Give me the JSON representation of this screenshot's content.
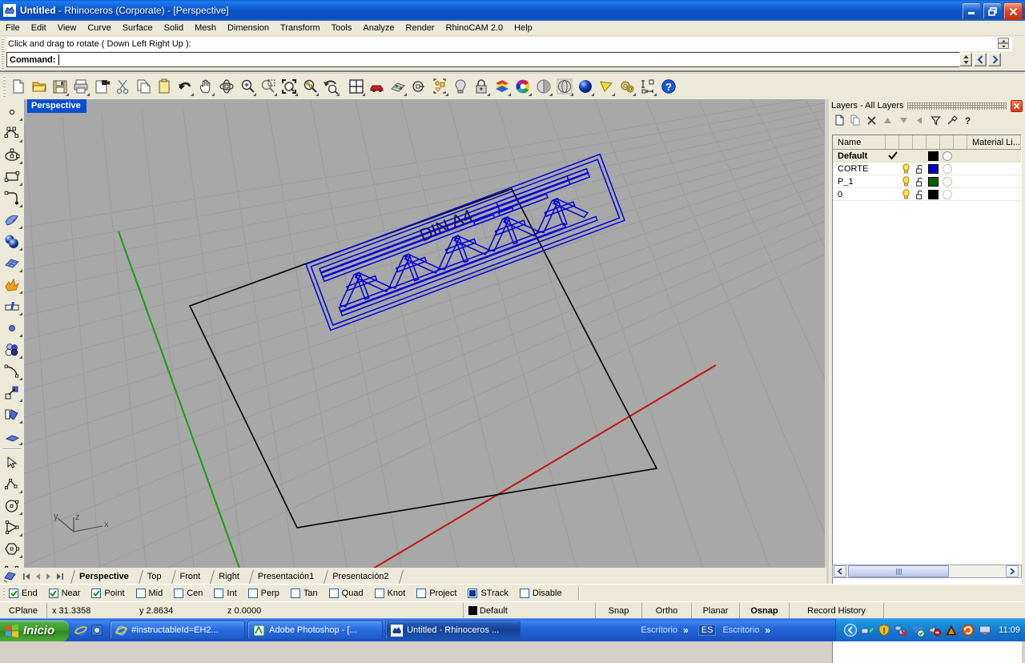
{
  "window": {
    "title_main": "Untitled",
    "title_rest": " - Rhinoceros (Corporate) - [Perspective]",
    "icon": "rhino-icon",
    "minimize_label": "minimize-icon",
    "restore_label": "restore-icon",
    "close_label": "close-icon"
  },
  "menu": {
    "items": [
      {
        "label": "File"
      },
      {
        "label": "Edit"
      },
      {
        "label": "View"
      },
      {
        "label": "Curve"
      },
      {
        "label": "Surface"
      },
      {
        "label": "Solid"
      },
      {
        "label": "Mesh"
      },
      {
        "label": "Dimension"
      },
      {
        "label": "Transform"
      },
      {
        "label": "Tools"
      },
      {
        "label": "Analyze"
      },
      {
        "label": "Render"
      },
      {
        "label": "RhinoCAM 2.0"
      },
      {
        "label": "Help"
      }
    ]
  },
  "command": {
    "prompt": "Click and drag to rotate ( Down  Left  Right  Up ):",
    "label": "Command:",
    "value": "",
    "placeholder": ""
  },
  "toolbar": {
    "tools": [
      {
        "name": "new-file-icon",
        "tip": "New"
      },
      {
        "name": "open-file-icon",
        "tip": "Open"
      },
      {
        "name": "save-file-icon",
        "tip": "Save"
      },
      {
        "name": "print-icon",
        "tip": "Print"
      },
      {
        "name": "copy-to-clipboard-icon",
        "tip": "Copy to clipboard"
      },
      {
        "name": "cut-icon",
        "tip": "Cut"
      },
      {
        "name": "copy-icon",
        "tip": "Copy"
      },
      {
        "name": "paste-icon",
        "tip": "Paste"
      },
      {
        "name": "undo-icon",
        "tip": "Undo"
      },
      {
        "name": "pan-hand-icon",
        "tip": "Pan"
      },
      {
        "name": "rotate-view-icon",
        "tip": "Rotate view"
      },
      {
        "name": "zoom-in-icon",
        "tip": "Zoom in"
      },
      {
        "name": "zoom-window-icon",
        "tip": "Zoom window"
      },
      {
        "name": "zoom-extents-icon",
        "tip": "Zoom extents"
      },
      {
        "name": "zoom-selected-icon",
        "tip": "Zoom selected"
      },
      {
        "name": "zoom-previous-icon",
        "tip": "Zoom previous"
      },
      {
        "name": "four-viewport-icon",
        "tip": "4 viewports"
      },
      {
        "name": "car-icon",
        "tip": "Named views"
      },
      {
        "name": "grid-plane-icon",
        "tip": "CPlane"
      },
      {
        "name": "named-cplane-icon",
        "tip": "Set CPlane"
      },
      {
        "name": "object-properties-icon",
        "tip": "Properties"
      },
      {
        "name": "light-bulb-icon",
        "tip": "Create light"
      },
      {
        "name": "lock-icon",
        "tip": "Lock object"
      },
      {
        "name": "layer-colors-icon",
        "tip": "Layers"
      },
      {
        "name": "color-wheel-icon",
        "tip": "Object color"
      },
      {
        "name": "shade-icon",
        "tip": "Shade"
      },
      {
        "name": "ghosted-icon",
        "tip": "Ghosted view"
      },
      {
        "name": "render-sphere-icon",
        "tip": "Render"
      },
      {
        "name": "spot-light-icon",
        "tip": "Spotlight"
      },
      {
        "name": "options-gear-icon",
        "tip": "Options"
      },
      {
        "name": "dimension-icon",
        "tip": "Dimension"
      },
      {
        "name": "help-icon",
        "tip": "Help"
      }
    ]
  },
  "left_toolbar": {
    "tools": [
      {
        "name": "point-icon"
      },
      {
        "name": "curve-control-points-icon"
      },
      {
        "name": "ellipse-icon"
      },
      {
        "name": "rectangle-icon"
      },
      {
        "name": "fillet-corner-icon"
      },
      {
        "name": "surface-edge-icon"
      },
      {
        "name": "sphere-solid-icon"
      },
      {
        "name": "surface-grid-icon"
      },
      {
        "name": "explode-icon"
      },
      {
        "name": "trim-icon"
      },
      {
        "name": "point-cloud-icon"
      },
      {
        "name": "two-points-icon"
      },
      {
        "name": "arc-icon"
      },
      {
        "name": "move-icon"
      },
      {
        "name": "rotate-object-icon"
      },
      {
        "name": "extrude-icon"
      },
      {
        "name": "select-arrow-icon"
      },
      {
        "name": "polyline-icon"
      },
      {
        "name": "circle-icon"
      },
      {
        "name": "polygon-icon"
      },
      {
        "name": "hexagon-icon"
      },
      {
        "name": "rect-plane-icon"
      }
    ]
  },
  "viewport": {
    "label": "Perspective",
    "sheet_label": "DIN A4",
    "axis": {
      "x": "x",
      "y": "y",
      "z": "z"
    },
    "background": "#a8a8a8",
    "grid_color": "#9a9a9a",
    "object_color": "#0000d8",
    "sheet_outline_color": "#000000",
    "axis_x_color": "#c00000",
    "axis_y_color": "#00a000"
  },
  "layers_panel": {
    "title": "Layers - All Layers",
    "buttons": [
      {
        "name": "new-layer-icon"
      },
      {
        "name": "duplicate-layer-icon"
      },
      {
        "name": "delete-layer-icon"
      },
      {
        "name": "move-up-icon"
      },
      {
        "name": "move-down-icon"
      },
      {
        "name": "move-left-icon"
      },
      {
        "name": "filter-icon"
      },
      {
        "name": "layer-tools-icon"
      },
      {
        "name": "help-icon"
      }
    ],
    "columns": [
      "Name",
      "",
      "",
      "",
      "",
      "",
      "",
      "Material Li..."
    ],
    "column_header_name": "Name",
    "column_header_material": "Material Li...",
    "rows": [
      {
        "name": "Default",
        "current": true,
        "on": false,
        "locked": false,
        "color": "#000000",
        "show_bulb": false,
        "show_lock": false
      },
      {
        "name": "CORTE",
        "current": false,
        "on": true,
        "locked": false,
        "color": "#0000cc",
        "show_bulb": true,
        "show_lock": true
      },
      {
        "name": "P_1",
        "current": false,
        "on": true,
        "locked": false,
        "color": "#006000",
        "show_bulb": true,
        "show_lock": true
      },
      {
        "name": "0",
        "current": false,
        "on": true,
        "locked": false,
        "color": "#000000",
        "show_bulb": true,
        "show_lock": true
      }
    ],
    "scroll": {
      "left_arrow": "❮",
      "right_arrow": "❯"
    }
  },
  "viewport_tabs": {
    "nav": [
      "first",
      "prev",
      "next",
      "last"
    ],
    "tabs": [
      {
        "label": "Perspective",
        "active": true
      },
      {
        "label": "Top",
        "active": false
      },
      {
        "label": "Front",
        "active": false
      },
      {
        "label": "Right",
        "active": false
      },
      {
        "label": "Presentación1",
        "active": false
      },
      {
        "label": "Presentación2",
        "active": false
      }
    ]
  },
  "osnap": {
    "items": [
      {
        "label": "End",
        "checked": true,
        "style": "check"
      },
      {
        "label": "Near",
        "checked": true,
        "style": "check"
      },
      {
        "label": "Point",
        "checked": true,
        "style": "check"
      },
      {
        "label": "Mid",
        "checked": false,
        "style": "check"
      },
      {
        "label": "Cen",
        "checked": false,
        "style": "check"
      },
      {
        "label": "Int",
        "checked": false,
        "style": "check"
      },
      {
        "label": "Perp",
        "checked": false,
        "style": "check"
      },
      {
        "label": "Tan",
        "checked": false,
        "style": "check"
      },
      {
        "label": "Quad",
        "checked": false,
        "style": "check"
      },
      {
        "label": "Knot",
        "checked": false,
        "style": "check"
      },
      {
        "label": "Project",
        "checked": false,
        "style": "check"
      },
      {
        "label": "STrack",
        "checked": false,
        "style": "filled"
      },
      {
        "label": "Disable",
        "checked": false,
        "style": "check"
      }
    ]
  },
  "statusbar": {
    "cplane": "CPlane",
    "x": "x 31.3358",
    "y": "y 2.8634",
    "z": "z 0.0000",
    "layer": "Default",
    "layer_color": "#000000",
    "snap": "Snap",
    "ortho": "Ortho",
    "planar": "Planar",
    "osnap": "Osnap",
    "record_history": "Record History"
  },
  "taskbar": {
    "start": "Inicio",
    "quick_launch": [
      {
        "name": "internet-explorer-icon"
      },
      {
        "name": "media-icon"
      }
    ],
    "tasks": [
      {
        "label": "#instructableId=EH2...",
        "icon": "internet-explorer-icon",
        "active": false
      },
      {
        "label": "Adobe Photoshop - [...",
        "icon": "photoshop-icon",
        "active": false
      },
      {
        "label": "Untitled - Rhinoceros ...",
        "icon": "rhino-icon",
        "active": true
      }
    ],
    "toolbars": [
      {
        "label": "Escritorio",
        "chevron": "»"
      },
      {
        "label": "ES",
        "boxed": true
      },
      {
        "label": "Escritorio",
        "chevron": "»"
      }
    ],
    "tray_icons": [
      {
        "name": "hide-arrow-icon"
      },
      {
        "name": "network-icon"
      },
      {
        "name": "warning-shield-icon"
      },
      {
        "name": "network-disconnected-icon"
      },
      {
        "name": "dropbox-icon"
      },
      {
        "name": "sound-muted-icon"
      },
      {
        "name": "autodesk-icon"
      },
      {
        "name": "update-icon"
      },
      {
        "name": "display-icon"
      }
    ],
    "clock": "11:09"
  }
}
